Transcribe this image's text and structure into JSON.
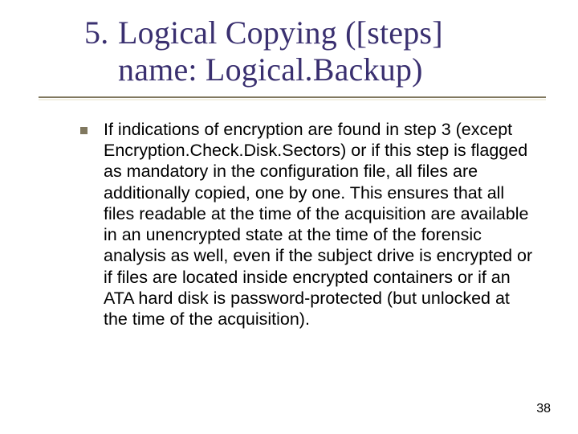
{
  "title": {
    "list_number": "5.",
    "line1_rest": "Logical Copying ([steps]",
    "line2": "name: Logical.Backup)"
  },
  "body": {
    "paragraph": "If indications of encryption are found in step 3 (except Encryption.Check.Disk.Sectors) or if this step is flagged as mandatory in the configuration file, all files are additionally copied, one by one. This ensures that all files readable at the time of the acquisition are available in an unencrypted state at the time of the forensic analysis as well, even if the subject drive is encrypted or if files are located inside encrypted containers or if an ATA hard disk is password-protected (but unlocked at the time of the acquisition)."
  },
  "page_number": "38"
}
